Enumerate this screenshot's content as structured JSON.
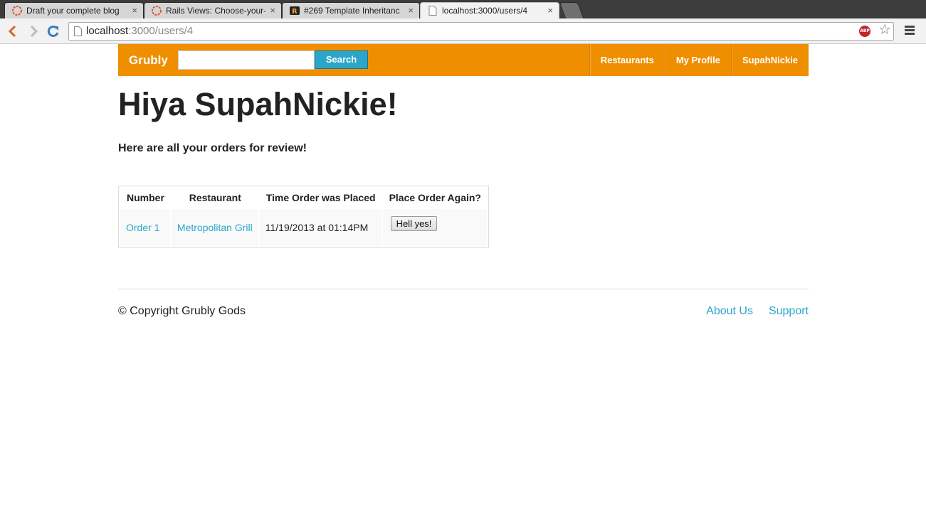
{
  "browser": {
    "tabs": [
      {
        "title": "Draft your complete blog",
        "active": false,
        "favicon": "wordpress-icon"
      },
      {
        "title": "Rails Views: Choose-your-",
        "active": false,
        "favicon": "wordpress-icon"
      },
      {
        "title": "#269 Template Inheritanc",
        "active": false,
        "favicon": "railscasts-icon"
      },
      {
        "title": "localhost:3000/users/4",
        "active": true,
        "favicon": "page-icon"
      }
    ],
    "close_glyph": "×",
    "address": {
      "host": "localhost",
      "path": ":3000/users/4"
    },
    "abp_label": "ABP",
    "star_glyph": "☆"
  },
  "navbar": {
    "brand": "Grubly",
    "search_value": "",
    "search_button": "Search",
    "links": [
      "Restaurants",
      "My Profile",
      "SupahNickie"
    ],
    "color": "#ef8f00"
  },
  "main": {
    "heading": "Hiya SupahNickie!",
    "subheading": "Here are all your orders for review!",
    "table": {
      "headers": [
        "Number",
        "Restaurant",
        "Time Order was Placed",
        "Place Order Again?"
      ],
      "rows": [
        {
          "number": "Order 1",
          "restaurant": "Metropolitan Grill",
          "time": "11/19/2013 at 01:14PM",
          "action": "Hell yes!"
        }
      ]
    }
  },
  "footer": {
    "copyright": "© Copyright Grubly Gods",
    "links": [
      "About Us",
      "Support"
    ]
  }
}
